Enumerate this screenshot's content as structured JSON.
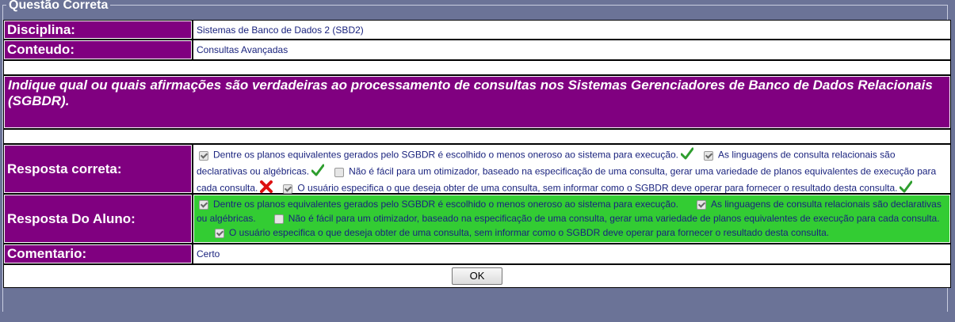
{
  "legend": "Questão Correta",
  "discipline": {
    "label": "Disciplina:",
    "value": "Sistemas de Banco de Dados 2 (SBD2)"
  },
  "content": {
    "label": "Conteudo:",
    "value": "Consultas Avançadas"
  },
  "question": "Indique qual ou quais afirmações são verdadeiras ao processamento de consultas nos Sistemas Gerenciadores de Banco de Dados Relacionais (SGBDR).",
  "correct_answer": {
    "label": "Resposta correta:",
    "options": [
      {
        "text": "Dentre os planos equivalentes gerados pelo SGBDR é escolhido o menos oneroso ao sistema para execução.",
        "checked": true,
        "mark": "check"
      },
      {
        "text": "As linguagens de consulta relacionais são declarativas ou algébricas.",
        "checked": true,
        "mark": "check"
      },
      {
        "text": "Não é fácil para um otimizador, baseado na especificação de uma consulta, gerar uma variedade de planos equivalentes de execução para cada consulta.",
        "checked": false,
        "mark": "cross"
      },
      {
        "text": "O usuário especifica o que deseja obter de uma consulta, sem informar como o SGBDR deve operar para fornecer o resultado desta consulta.",
        "checked": true,
        "mark": "check"
      }
    ]
  },
  "student_answer": {
    "label": "Resposta Do Aluno:",
    "options": [
      {
        "text": "Dentre os planos equivalentes gerados pelo SGBDR é escolhido o menos oneroso ao sistema para execução.",
        "checked": true
      },
      {
        "text": "As linguagens de consulta relacionais são declarativas ou algébricas.",
        "checked": true
      },
      {
        "text": "Não é fácil para um otimizador, baseado na especificação de uma consulta, gerar uma variedade de planos equivalentes de execução para cada consulta.",
        "checked": false
      },
      {
        "text": "O usuário especifica o que deseja obter de uma consulta, sem informar como o SGBDR deve operar para fornecer o resultado desta consulta.",
        "checked": true
      }
    ]
  },
  "comment": {
    "label": "Comentario:",
    "value": "Certo"
  },
  "ok_button": "OK",
  "colors": {
    "header_purple": "#800080",
    "student_green": "#33cc33",
    "background": "#6b7397",
    "text_blue": "#1a237e"
  }
}
